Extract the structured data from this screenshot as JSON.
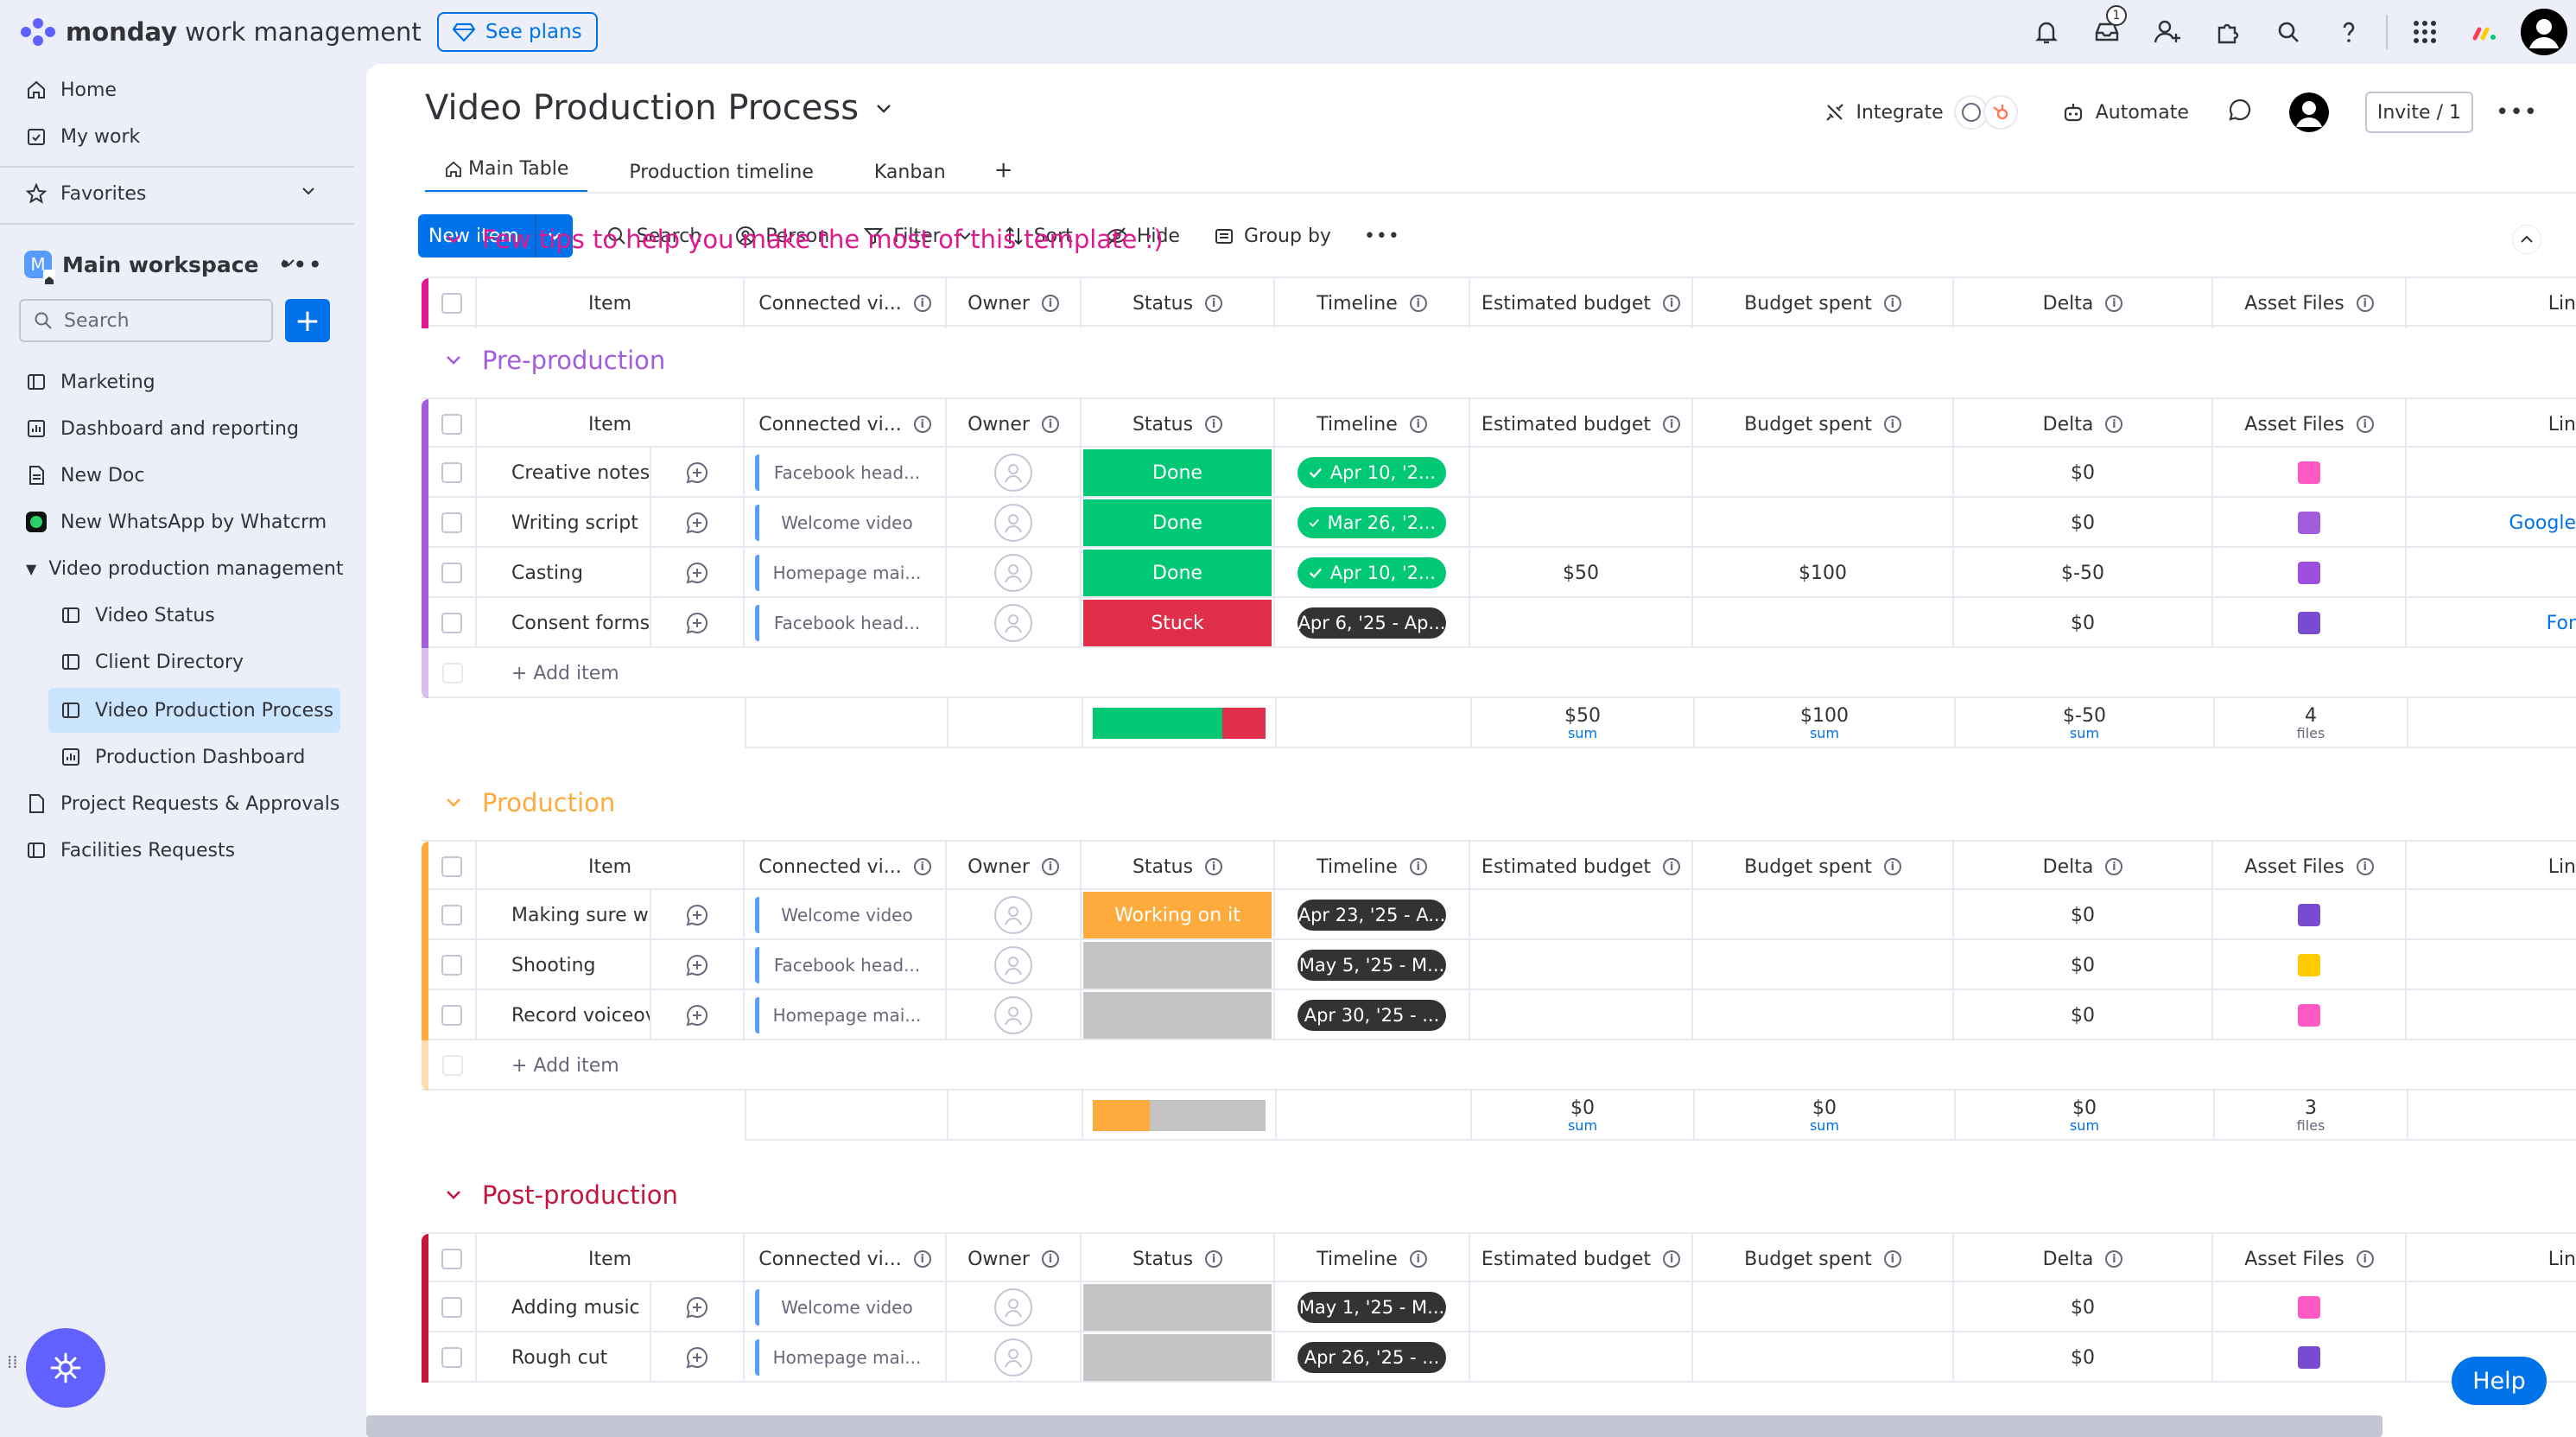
{
  "topbar": {
    "brand_name": "monday",
    "brand_sub": "work management",
    "see_plans": "See plans",
    "inbox_badge": "1"
  },
  "sidebar": {
    "home": "Home",
    "my_work": "My work",
    "favorites": "Favorites",
    "workspace_initial": "M",
    "workspace_name": "Main workspace",
    "search_placeholder": "Search",
    "items": [
      {
        "label": "Marketing"
      },
      {
        "label": "Dashboard and reporting"
      },
      {
        "label": "New Doc"
      },
      {
        "label": "New WhatsApp by Whatcrm"
      },
      {
        "label": "Video production management"
      },
      {
        "label": "Video Status"
      },
      {
        "label": "Client Directory"
      },
      {
        "label": "Video Production Process"
      },
      {
        "label": "Production Dashboard"
      },
      {
        "label": "Project Requests & Approvals"
      },
      {
        "label": "Facilities Requests"
      }
    ]
  },
  "board": {
    "title": "Video Production Process",
    "integrate": "Integrate",
    "automate": "Automate",
    "invite": "Invite / 1",
    "tabs": [
      {
        "label": "Main Table"
      },
      {
        "label": "Production timeline"
      },
      {
        "label": "Kanban"
      }
    ],
    "add_tab": "+"
  },
  "toolbar": {
    "new_item": "New item",
    "search": "Search",
    "person": "Person",
    "filter": "Filter",
    "sort": "Sort",
    "hide": "Hide",
    "group_by": "Group by"
  },
  "columns": {
    "item": "Item",
    "connected": "Connected vi...",
    "owner": "Owner",
    "status": "Status",
    "timeline": "Timeline",
    "estimated": "Estimated budget",
    "spent": "Budget spent",
    "delta": "Delta",
    "assets": "Asset Files",
    "link": "Lin"
  },
  "colors": {
    "done": "#00c875",
    "stuck": "#df2f4a",
    "working": "#fdab3d",
    "empty": "#c4c4c4",
    "dark_pill": "#333333",
    "pink": "#e2188f",
    "purple": "#a25ddc",
    "orange": "#fdab3d",
    "red": "#c4163c"
  },
  "groups": [
    {
      "title": "Few tips to help you make the most of this template :)",
      "color": "#e2188f",
      "rows": []
    },
    {
      "title": "Pre-production",
      "color": "#a25ddc",
      "rows": [
        {
          "item": "Creative notes",
          "connected": "Facebook head...",
          "status": "Done",
          "status_color": "#00c875",
          "timeline": "Apr 10, '2...",
          "timeline_color": "#00c875",
          "check": true,
          "estimated": "",
          "spent": "",
          "delta": "$0",
          "asset_color": "#ff5ac4",
          "link": ""
        },
        {
          "item": "Writing script",
          "connected": "Welcome video",
          "status": "Done",
          "status_color": "#00c875",
          "timeline": "Mar 26, '2...",
          "timeline_color": "#00c875",
          "check": true,
          "estimated": "",
          "spent": "",
          "delta": "$0",
          "asset_color": "#a25ddc",
          "link": "Google"
        },
        {
          "item": "Casting",
          "connected": "Homepage mai...",
          "status": "Done",
          "status_color": "#00c875",
          "timeline": "Apr 10, '2...",
          "timeline_color": "#00c875",
          "check": true,
          "estimated": "$50",
          "spent": "$100",
          "delta": "$-50",
          "asset_color": "#9d50dd",
          "link": ""
        },
        {
          "item": "Consent forms",
          "connected": "Facebook head...",
          "status": "Stuck",
          "status_color": "#df2f4a",
          "timeline": "Apr 6, '25 - Ap...",
          "timeline_color": "#333333",
          "check": false,
          "estimated": "",
          "spent": "",
          "delta": "$0",
          "asset_color": "#784bd1",
          "link": "For"
        }
      ],
      "add_item": "+ Add item",
      "summary": {
        "estimated": "$50",
        "spent": "$100",
        "delta": "$-50",
        "files": "4",
        "sum_label": "sum",
        "files_label": "files",
        "status_bar": [
          {
            "color": "#00c875",
            "share": 0.75
          },
          {
            "color": "#df2f4a",
            "share": 0.25
          }
        ]
      }
    },
    {
      "title": "Production",
      "color": "#fdab3d",
      "rows": [
        {
          "item": "Making sure we ha...",
          "connected": "Welcome video",
          "status": "Working on it",
          "status_color": "#fdab3d",
          "timeline": "Apr 23, '25 - A...",
          "timeline_color": "#333333",
          "check": false,
          "estimated": "",
          "spent": "",
          "delta": "$0",
          "asset_color": "#784bd1",
          "link": ""
        },
        {
          "item": "Shooting",
          "connected": "Facebook head...",
          "status": "",
          "status_color": "#c4c4c4",
          "timeline": "May 5, '25 - M...",
          "timeline_color": "#333333",
          "check": false,
          "estimated": "",
          "spent": "",
          "delta": "$0",
          "asset_color": "#ffcb00",
          "link": ""
        },
        {
          "item": "Record voiceover",
          "connected": "Homepage mai...",
          "status": "",
          "status_color": "#c4c4c4",
          "timeline": "Apr 30, '25 - ...",
          "timeline_color": "#333333",
          "check": false,
          "estimated": "",
          "spent": "",
          "delta": "$0",
          "asset_color": "#ff5ac4",
          "link": ""
        }
      ],
      "add_item": "+ Add item",
      "summary": {
        "estimated": "$0",
        "spent": "$0",
        "delta": "$0",
        "files": "3",
        "sum_label": "sum",
        "files_label": "files",
        "status_bar": [
          {
            "color": "#fdab3d",
            "share": 0.33
          },
          {
            "color": "#c4c4c4",
            "share": 0.67
          }
        ]
      }
    },
    {
      "title": "Post-production",
      "color": "#c4163c",
      "rows": [
        {
          "item": "Adding music",
          "connected": "Welcome video",
          "status": "",
          "status_color": "#c4c4c4",
          "timeline": "May 1, '25 - M...",
          "timeline_color": "#333333",
          "check": false,
          "estimated": "",
          "spent": "",
          "delta": "$0",
          "asset_color": "#ff5ac4",
          "link": ""
        },
        {
          "item": "Rough cut",
          "connected": "Homepage mai...",
          "status": "",
          "status_color": "#c4c4c4",
          "timeline": "Apr 26, '25 - ...",
          "timeline_color": "#333333",
          "check": false,
          "estimated": "",
          "spent": "",
          "delta": "$0",
          "asset_color": "#784bd1",
          "link": ""
        }
      ]
    }
  ],
  "help": "Help"
}
